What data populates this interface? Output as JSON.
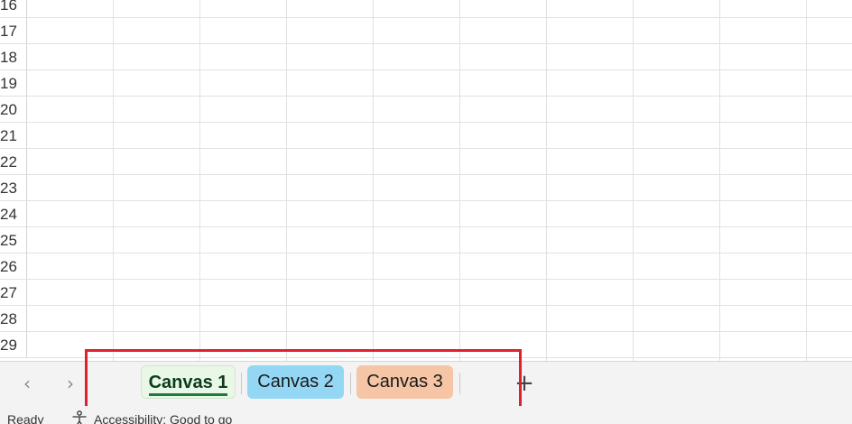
{
  "grid": {
    "row_numbers": [
      "16",
      "17",
      "18",
      "19",
      "20",
      "21",
      "22",
      "23",
      "24",
      "25",
      "26",
      "27",
      "28",
      "29"
    ]
  },
  "sheet_nav": {
    "prev_icon": "chevron-left-icon",
    "next_icon": "chevron-right-icon"
  },
  "sheet_tabs": [
    {
      "label": "Canvas 1",
      "color": "#e9f7e6",
      "active": true
    },
    {
      "label": "Canvas 2",
      "color": "#93d7f5",
      "active": false
    },
    {
      "label": "Canvas 3",
      "color": "#f5c5a5",
      "active": false
    }
  ],
  "add_sheet": {
    "icon": "plus-icon",
    "label": "+"
  },
  "highlight_color": "#e0202a",
  "status": {
    "ready": "Ready",
    "accessibility": "Accessibility: Good to go",
    "accessibility_icon": "accessibility-person-icon"
  }
}
